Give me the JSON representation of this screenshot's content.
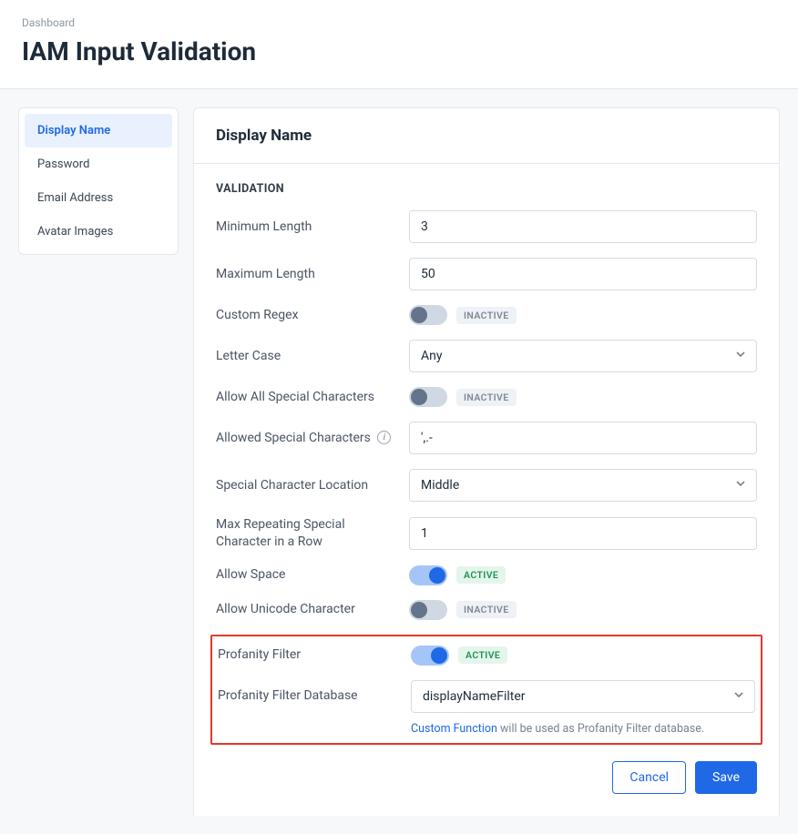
{
  "breadcrumb": "Dashboard",
  "page_title": "IAM Input Validation",
  "sidebar": {
    "items": [
      {
        "label": "Display Name",
        "active": true
      },
      {
        "label": "Password"
      },
      {
        "label": "Email Address"
      },
      {
        "label": "Avatar Images"
      }
    ]
  },
  "panel": {
    "title": "Display Name",
    "section_label": "VALIDATION"
  },
  "fields": {
    "min_length": {
      "label": "Minimum Length",
      "value": "3"
    },
    "max_length": {
      "label": "Maximum Length",
      "value": "50"
    },
    "custom_regex": {
      "label": "Custom Regex",
      "badge": "INACTIVE"
    },
    "letter_case": {
      "label": "Letter Case",
      "value": "Any"
    },
    "allow_all_special": {
      "label": "Allow All Special Characters",
      "badge": "INACTIVE"
    },
    "allowed_special_chars": {
      "label": "Allowed Special Characters",
      "value": "',.-"
    },
    "special_char_location": {
      "label": "Special Character Location",
      "value": "Middle"
    },
    "max_repeating": {
      "label": "Max Repeating Special Character in a Row",
      "value": "1"
    },
    "allow_space": {
      "label": "Allow Space",
      "badge": "ACTIVE"
    },
    "allow_unicode": {
      "label": "Allow Unicode Character",
      "badge": "INACTIVE"
    },
    "profanity_filter": {
      "label": "Profanity Filter",
      "badge": "ACTIVE"
    },
    "profanity_db": {
      "label": "Profanity Filter Database",
      "value": "displayNameFilter"
    }
  },
  "hint": {
    "link": "Custom Function",
    "text": " will be used as Profanity Filter database."
  },
  "actions": {
    "cancel": "Cancel",
    "save": "Save"
  }
}
